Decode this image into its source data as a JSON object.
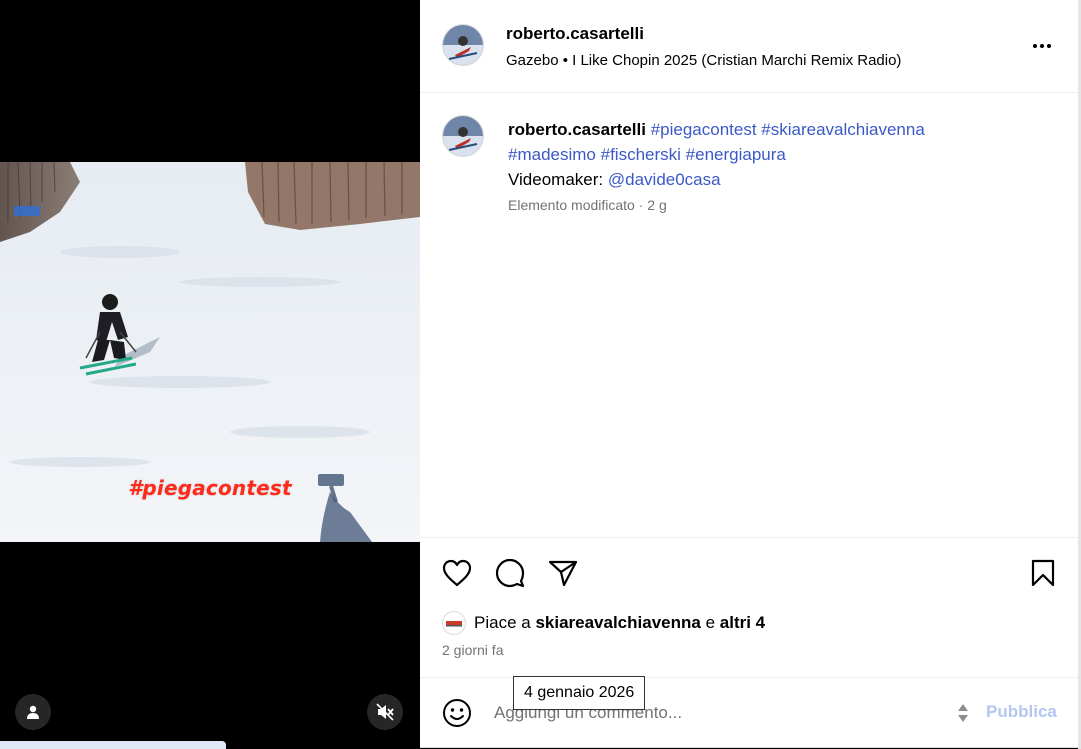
{
  "video": {
    "overlay_text": "#piegacontest"
  },
  "post": {
    "author": "roberto.casartelli",
    "music": "Gazebo • I Like Chopin 2025 (Cristian Marchi Remix Radio)",
    "caption": {
      "username": "roberto.casartelli",
      "hashtags_line1": [
        "#piegacontest",
        "#skiareavalchiavenna"
      ],
      "hashtags_line2": [
        "#madesimo",
        "#fischerski",
        "#energiapura"
      ],
      "videomaker_label": "Videomaker:",
      "videomaker_handle": "@davide0casa",
      "meta": "Elemento modificato · 2 g"
    },
    "likes": {
      "prefix": "Piace a",
      "first_user": "skiareavalchiavenna",
      "connector": "e",
      "others": "altri 4"
    },
    "time_ago": "2 giorni fa",
    "date_tooltip": "4 gennaio 2026"
  },
  "comment_box": {
    "placeholder": "Aggiungi un commento...",
    "publish_label": "Pubblica"
  },
  "icons": {
    "like": "heart-icon",
    "comment": "comment-bubble-icon",
    "share": "paper-plane-icon",
    "save": "bookmark-icon",
    "more": "more-dots-icon",
    "emoji": "emoji-icon",
    "user_tags": "user-tags-icon",
    "mute": "speaker-muted-icon"
  },
  "colors": {
    "link": "#3b59c7",
    "overlay_tag": "#ff2a1a",
    "publish_disabled": "#b3c7f2",
    "secondary_text": "#737373"
  }
}
